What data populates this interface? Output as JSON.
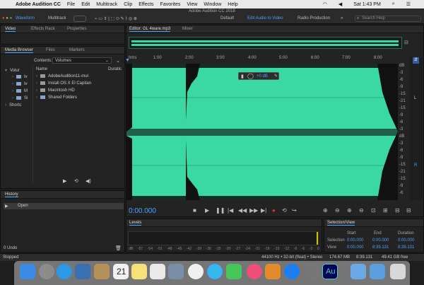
{
  "menubar": {
    "app": "Adobe Audition CC",
    "items": [
      "File",
      "Edit",
      "Multitrack",
      "Clip",
      "Effects",
      "Favorites",
      "View",
      "Window",
      "Help"
    ],
    "clock": "Sat 1:43 PM"
  },
  "toolbar": {
    "title": "Adobe Audition CC 2018",
    "waveform": "Waveform",
    "multitrack": "Multitrack",
    "default": "Default",
    "edit_audio": "Edit Audio to Video",
    "radio": "Radio Production",
    "search": "Search Help"
  },
  "left": {
    "tabs": [
      "Video",
      "Effects Rack",
      "Properties"
    ],
    "media_tabs": [
      "Media Browser",
      "Files",
      "Markers"
    ],
    "contents_label": "Contents:",
    "contents_value": "Volumes",
    "tree": [
      "Volur",
      "Iv",
      "Iv",
      "M",
      "Si",
      "Shortc"
    ],
    "col_name": "Name",
    "col_dur": "Duratic",
    "items": [
      "AdobeAudition11-mul",
      "Install OS X El Capitan",
      "Macintosh HD",
      "Shared Folders"
    ],
    "history_title": "History",
    "history_item": "Open",
    "undo": "0 Undo",
    "status": "Stopped"
  },
  "editor": {
    "tab": "Editor: GL 4ware.mp3",
    "mixer": "Mixer",
    "ruler": [
      "hms",
      "1:00",
      "2:00",
      "3:00",
      "4:00",
      "5:00",
      "6:00",
      "7:00",
      "8:00"
    ],
    "hud_gain": "+0 dB",
    "db_scale": [
      "dB",
      "-3",
      "-6",
      "-9",
      "-15",
      "-21",
      "-15",
      "-9",
      "-6",
      "-3",
      "dB",
      "-3",
      "-6",
      "-9",
      "-15",
      "-21",
      "-15",
      "-9",
      "-6",
      "-3"
    ],
    "channels": [
      "L",
      "R"
    ],
    "time": "0:00.000"
  },
  "levels": {
    "title": "Levels",
    "scale": [
      "dB",
      "-57",
      "-54",
      "-51",
      "-48",
      "-45",
      "-42",
      "-39",
      "-36",
      "-33",
      "-30",
      "-27",
      "-24",
      "-21",
      "-18",
      "-15",
      "-12",
      "-9",
      "-6",
      "-3",
      "0"
    ]
  },
  "selection": {
    "title": "Selection/View",
    "headers": [
      "Start",
      "End",
      "Duration"
    ],
    "rows": [
      {
        "label": "Selection",
        "start": "0:00.000",
        "end": "0:00.000",
        "dur": "0:00.000"
      },
      {
        "label": "View",
        "start": "0:00.000",
        "end": "8:39.131",
        "dur": "8:39.131"
      }
    ]
  },
  "statusbar": {
    "format": "44100 Hz • 32-bit (float) • Stereo",
    "size": "174.67 MB",
    "duration": "8:39.131",
    "free": "49.41 GB free"
  },
  "colors": {
    "wave": "#3ad8a2",
    "accent": "#4a9fff",
    "record": "#e0342b"
  }
}
